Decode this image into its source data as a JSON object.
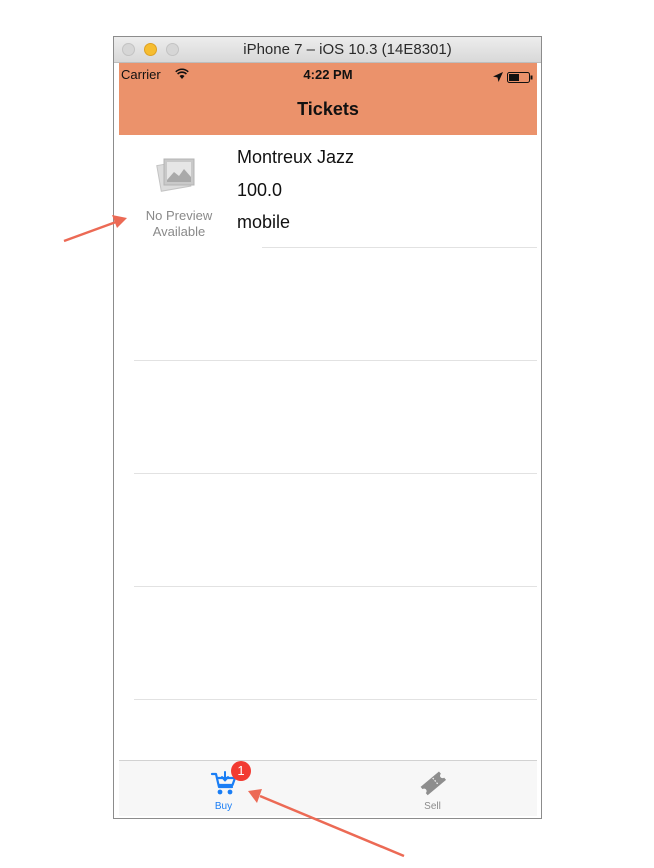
{
  "window": {
    "title": "iPhone 7 – iOS 10.3 (14E8301)"
  },
  "status_bar": {
    "carrier": "Carrier",
    "time": "4:22 PM"
  },
  "nav_bar": {
    "title": "Tickets",
    "background_color": "#eb926b"
  },
  "tickets": [
    {
      "name": "Montreux Jazz",
      "price": "100.0",
      "type": "mobile",
      "image_placeholder": "No Preview Available"
    }
  ],
  "tab_bar": {
    "tabs": [
      {
        "label": "Buy",
        "icon": "cart-icon",
        "selected": true,
        "badge": "1"
      },
      {
        "label": "Sell",
        "icon": "ticket-icon",
        "selected": false
      }
    ],
    "accent_color": "#1a7ef5"
  }
}
